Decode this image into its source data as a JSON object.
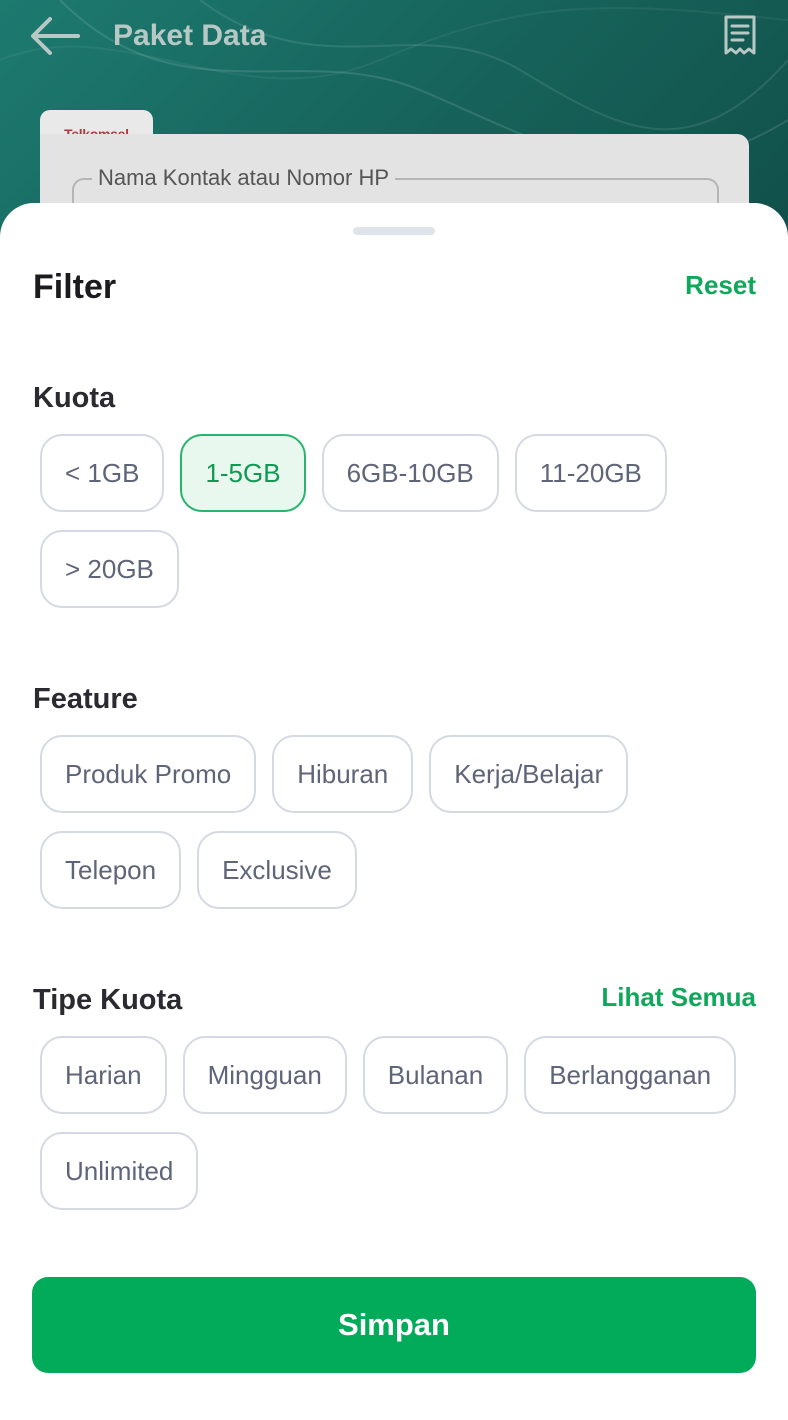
{
  "header": {
    "title": "Paket Data",
    "back_icon": "arrow-left-icon",
    "history_icon": "receipt-icon"
  },
  "phone_card": {
    "operator": "Telkomsel",
    "field_label": "Nama Kontak atau Nomor HP"
  },
  "filter": {
    "title": "Filter",
    "reset_label": "Reset",
    "sections": {
      "kuota": {
        "title": "Kuota",
        "options": [
          "< 1GB",
          "1-5GB",
          "6GB-10GB",
          "11-20GB",
          "> 20GB"
        ],
        "selected": "1-5GB"
      },
      "feature": {
        "title": "Feature",
        "options": [
          "Produk Promo",
          "Hiburan",
          "Kerja/Belajar",
          "Telepon",
          "Exclusive"
        ]
      },
      "tipe_kuota": {
        "title": "Tipe Kuota",
        "action_label": "Lihat Semua",
        "options": [
          "Harian",
          "Mingguan",
          "Bulanan",
          "Berlangganan",
          "Unlimited"
        ]
      }
    },
    "save_label": "Simpan"
  },
  "colors": {
    "accent": "#02ab59",
    "header_bg": "#1d7a6f",
    "chip_border": "#d4d9e2",
    "chip_selected_bg": "#e9f8ef"
  }
}
